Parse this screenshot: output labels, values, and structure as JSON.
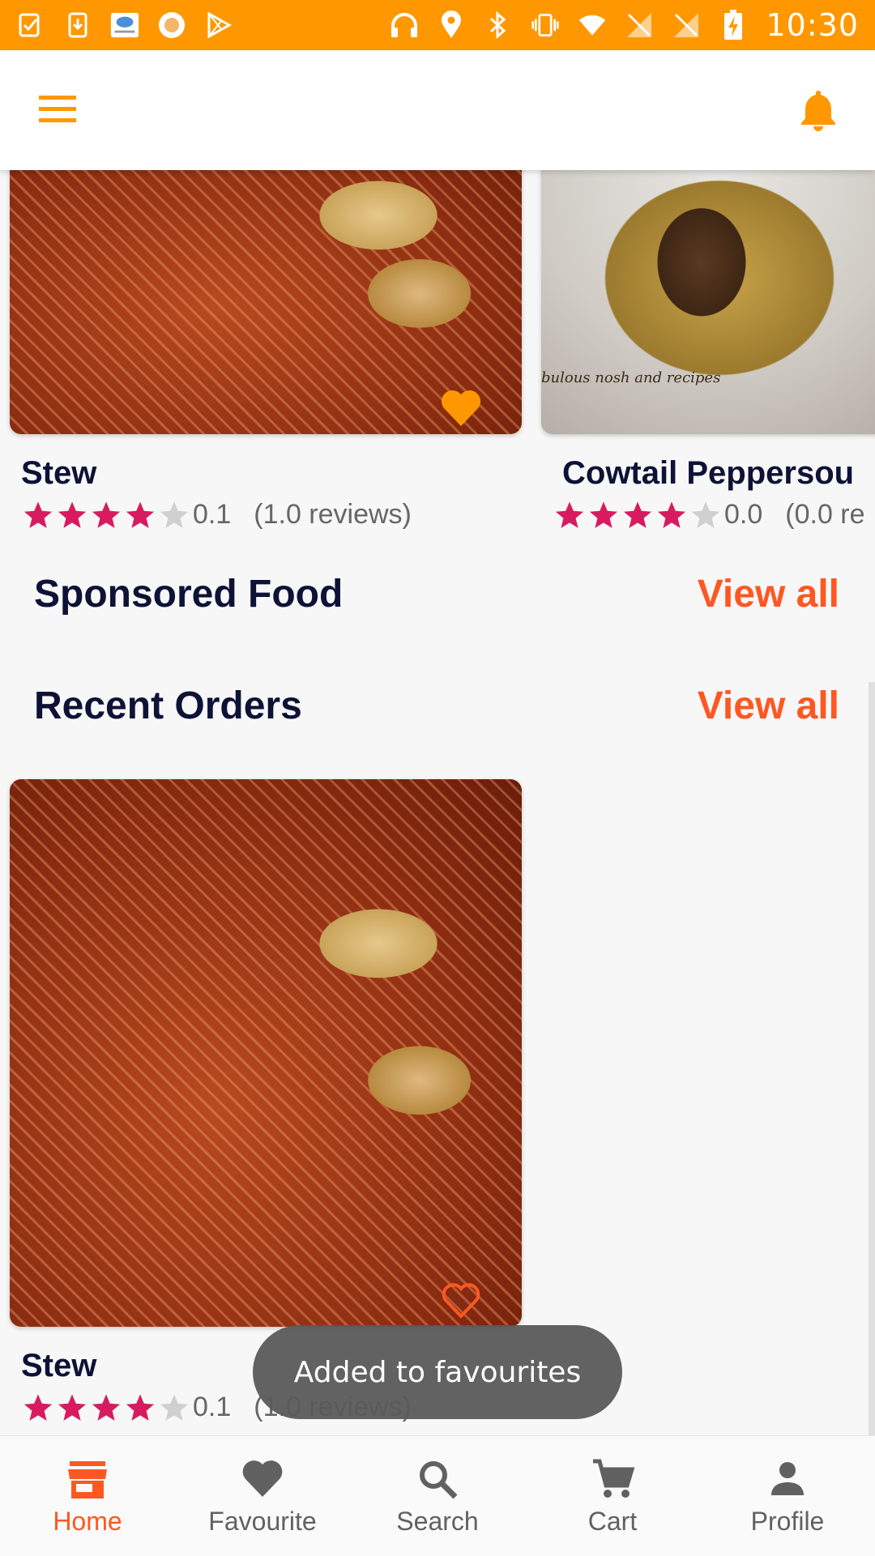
{
  "status_bar": {
    "time": "10:30",
    "background": "#ff9800"
  },
  "app_bar": {
    "menu_icon": "hamburger-menu-icon",
    "notification_icon": "bell-icon"
  },
  "popular": [
    {
      "name": "Stew",
      "rating": "0.1",
      "stars": 4,
      "reviews": "(1.0 reviews)",
      "favourite": true
    },
    {
      "name": "Cowtail Peppersou",
      "rating": "0.0",
      "stars": 4,
      "reviews": "(0.0 re",
      "photo_caption": "bulous nosh and recipes"
    }
  ],
  "sections": {
    "sponsored": {
      "title": "Sponsored Food",
      "view_all": "View all"
    },
    "recent": {
      "title": "Recent Orders",
      "view_all": "View all"
    }
  },
  "recent_orders": [
    {
      "name": "Stew",
      "rating": "0.1",
      "stars": 4,
      "reviews": "(1.0 reviews)",
      "favourite": false
    }
  ],
  "toast": "Added to favourites",
  "bottom_nav": [
    {
      "label": "Home",
      "icon": "store-icon",
      "active": true
    },
    {
      "label": "Favourite",
      "icon": "heart-icon",
      "active": false
    },
    {
      "label": "Search",
      "icon": "search-icon",
      "active": false
    },
    {
      "label": "Cart",
      "icon": "cart-icon",
      "active": false
    },
    {
      "label": "Profile",
      "icon": "person-icon",
      "active": false
    }
  ],
  "colors": {
    "accent": "#ff5722",
    "star": "#d81b60",
    "brand": "#ff9800",
    "title": "#0d1236"
  }
}
